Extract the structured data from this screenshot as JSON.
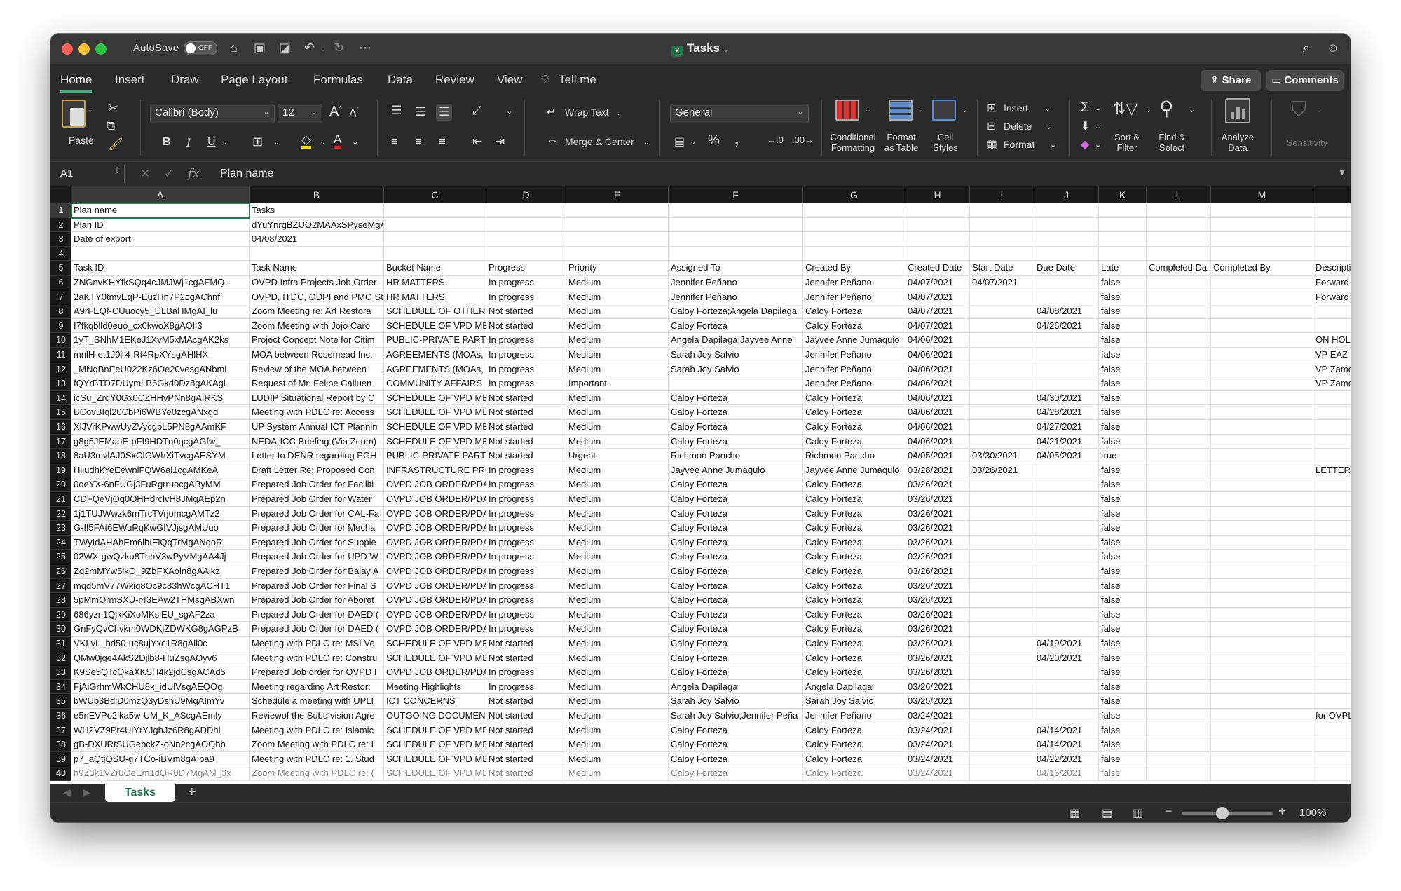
{
  "titlebar": {
    "autosave_label": "AutoSave",
    "autosave_state": "OFF",
    "doc_title": "Tasks",
    "xl_icon_letter": "X"
  },
  "ribbon_tabs": [
    "Home",
    "Insert",
    "Draw",
    "Page Layout",
    "Formulas",
    "Data",
    "Review",
    "View",
    "Tell me"
  ],
  "actions": {
    "share": "Share",
    "comments": "Comments"
  },
  "ribbon": {
    "paste": "Paste",
    "font_name": "Calibri (Body)",
    "font_size": "12",
    "wrap_text": "Wrap Text",
    "merge_center": "Merge & Center",
    "number_format": "General",
    "conditional_formatting": [
      "Conditional",
      "Formatting"
    ],
    "format_as_table": [
      "Format",
      "as Table"
    ],
    "cell_styles": [
      "Cell",
      "Styles"
    ],
    "insert": "Insert",
    "delete": "Delete",
    "format": "Format",
    "sort_filter": [
      "Sort &",
      "Filter"
    ],
    "find_select": [
      "Find &",
      "Select"
    ],
    "analyze_data": [
      "Analyze",
      "Data"
    ],
    "sensitivity": "Sensitivity",
    "bold": "B",
    "italic": "I",
    "underline": "U",
    "percent": "%",
    "comma": ",",
    "font_grow": "A",
    "font_shrink": "A"
  },
  "formula_bar": {
    "name_box": "A1",
    "fx": "fx",
    "formula": "Plan name"
  },
  "columns": [
    "A",
    "B",
    "C",
    "D",
    "E",
    "F",
    "G",
    "H",
    "I",
    "J",
    "K",
    "L",
    "M",
    ""
  ],
  "rows": [
    [
      "Plan name",
      "Tasks",
      "",
      "",
      "",
      "",
      "",
      "",
      "",
      "",
      "",
      "",
      "",
      ""
    ],
    [
      "Plan ID",
      "dYuYnrgBZUO2MAAxSPyseMgAFGOi",
      "",
      "",
      "",
      "",
      "",
      "",
      "",
      "",
      "",
      "",
      "",
      ""
    ],
    [
      "Date of export",
      "04/08/2021",
      "",
      "",
      "",
      "",
      "",
      "",
      "",
      "",
      "",
      "",
      "",
      ""
    ],
    [
      "",
      "",
      "",
      "",
      "",
      "",
      "",
      "",
      "",
      "",
      "",
      "",
      "",
      ""
    ],
    [
      "Task ID",
      "Task Name",
      "Bucket Name",
      "Progress",
      "Priority",
      "Assigned To",
      "Created By",
      "Created Date",
      "Start Date",
      "Due Date",
      "Late",
      "Completed Da",
      "Completed By",
      "Descripti"
    ],
    [
      "ZNGnvKHYfkSQq4cJMJWj1cgAFMQ-",
      "OVPD Infra Projects Job Order",
      "HR MATTERS",
      "In progress",
      "Medium",
      "Jennifer Peñano",
      "Jennifer Peñano",
      "04/07/2021",
      "04/07/2021",
      "",
      "false",
      "",
      "",
      "Forward"
    ],
    [
      "2aKTY0tmvEqP-EuzHn7P2cgAChnf",
      "OVPD, ITDC, ODPI and PMO St",
      "HR MATTERS",
      "In progress",
      "Medium",
      "Jennifer Peñano",
      "Jennifer Peñano",
      "04/07/2021",
      "",
      "",
      "false",
      "",
      "",
      "Forward"
    ],
    [
      "A9rFEQf-CUuocy5_ULBaHMgAI_lu",
      "Zoom Meeting re: Art Restora",
      "SCHEDULE OF OTHER I",
      "Not started",
      "Medium",
      "Caloy Forteza;Angela Dapilaga",
      "Caloy Forteza",
      "04/07/2021",
      "",
      "04/08/2021",
      "false",
      "",
      "",
      ""
    ],
    [
      "I7fkqblld0euo_cx0kwoX8gAOlI3",
      "Zoom Meeting with Jojo Caro",
      "SCHEDULE OF VPD ME",
      "Not started",
      "Medium",
      "Caloy Forteza",
      "Caloy Forteza",
      "04/07/2021",
      "",
      "04/26/2021",
      "false",
      "",
      "",
      ""
    ],
    [
      "1yT_SNhM1EKeJ1XvM5xMAcgAK2ks",
      "Project Concept Note for Citim",
      "PUBLIC-PRIVATE PART",
      "In progress",
      "Medium",
      "Angela Dapilaga;Jayvee Anne",
      "Jayvee Anne Jumaquio",
      "04/06/2021",
      "",
      "",
      "false",
      "",
      "",
      "ON HOLD"
    ],
    [
      "mnlH-et1J0i-4-Rt4RpXYsgAHlHX",
      "MOA between Rosemead Inc.",
      "AGREEMENTS (MOAs,",
      "In progress",
      "Medium",
      "Sarah Joy Salvio",
      "Jennifer Peñano",
      "04/06/2021",
      "",
      "",
      "false",
      "",
      "",
      "VP EAZ t"
    ],
    [
      "_MNqBnEeU022Kz6Oe20vesgANbml",
      "Review of the MOA between",
      "AGREEMENTS (MOAs,",
      "In progress",
      "Medium",
      "Sarah Joy Salvio",
      "Jennifer Peñano",
      "04/06/2021",
      "",
      "",
      "false",
      "",
      "",
      "VP Zamo"
    ],
    [
      "fQYrBTD7DUymLB6Gkd0Dz8gAKAgl",
      "Request of Mr. Felipe Calluen",
      "COMMUNITY AFFAIRS",
      "In progress",
      "Important",
      "",
      "Jennifer Peñano",
      "04/06/2021",
      "",
      "",
      "false",
      "",
      "",
      "VP Zamo"
    ],
    [
      "icSu_ZrdY0Gx0CZHHvPNn8gAIRKS",
      "LUDIP Situational Report by C",
      "SCHEDULE OF VPD ME",
      "Not started",
      "Medium",
      "Caloy Forteza",
      "Caloy Forteza",
      "04/06/2021",
      "",
      "04/30/2021",
      "false",
      "",
      "",
      ""
    ],
    [
      "BCovBIql20CbPi6WBYe0zcgANxgd",
      "Meeting with PDLC re: Access",
      "SCHEDULE OF VPD ME",
      "Not started",
      "Medium",
      "Caloy Forteza",
      "Caloy Forteza",
      "04/06/2021",
      "",
      "04/28/2021",
      "false",
      "",
      "",
      ""
    ],
    [
      "XlJVrKPwwUyZVycgpL5PN8gAAmKF",
      "UP System Annual ICT Plannin",
      "SCHEDULE OF VPD ME",
      "Not started",
      "Medium",
      "Caloy Forteza",
      "Caloy Forteza",
      "04/06/2021",
      "",
      "04/27/2021",
      "false",
      "",
      "",
      ""
    ],
    [
      "g8g5JEMaoE-pFI9HDTq0qcgAGfw_",
      "NEDA-ICC Briefing (Via Zoom)",
      "SCHEDULE OF VPD ME",
      "Not started",
      "Medium",
      "Caloy Forteza",
      "Caloy Forteza",
      "04/06/2021",
      "",
      "04/21/2021",
      "false",
      "",
      "",
      ""
    ],
    [
      "8aU3mvlAJ0SxCIGWhXiTvcgAESYM",
      "Letter to DENR regarding PGH",
      "PUBLIC-PRIVATE PART",
      "Not started",
      "Urgent",
      "Richmon Pancho",
      "Richmon Pancho",
      "04/05/2021",
      "03/30/2021",
      "04/05/2021",
      "true",
      "",
      "",
      ""
    ],
    [
      "HiiudhkYeEewnlFQW6al1cgAMKeA",
      "Draft Letter Re: Proposed Con",
      "INFRASTRUCTURE PRC",
      "In progress",
      "Medium",
      "Jayvee Anne Jumaquio",
      "Jayvee Anne Jumaquio",
      "03/28/2021",
      "03/26/2021",
      "",
      "false",
      "",
      "",
      "LETTER C"
    ],
    [
      "0oeYX-6nFUGj3FuRgrruocgAByMM",
      "Prepared Job Order for Faciliti",
      "OVPD JOB ORDER/PDA",
      "In progress",
      "Medium",
      "Caloy Forteza",
      "Caloy Forteza",
      "03/26/2021",
      "",
      "",
      "false",
      "",
      "",
      ""
    ],
    [
      "CDFQeVjOq0OHHdrclvH8JMgAEp2n",
      "Prepared Job Order for Water",
      "OVPD JOB ORDER/PDA",
      "In progress",
      "Medium",
      "Caloy Forteza",
      "Caloy Forteza",
      "03/26/2021",
      "",
      "",
      "false",
      "",
      "",
      ""
    ],
    [
      "1j1TUJWwzk6mTrcTVrjomcgAMTz2",
      "Prepared Job Order for CAL-Fa",
      "OVPD JOB ORDER/PDA",
      "In progress",
      "Medium",
      "Caloy Forteza",
      "Caloy Forteza",
      "03/26/2021",
      "",
      "",
      "false",
      "",
      "",
      ""
    ],
    [
      "G-ff5FAt6EWuRqKwGIVJjsgAMUuo",
      "Prepared Job Order for Mecha",
      "OVPD JOB ORDER/PDA",
      "In progress",
      "Medium",
      "Caloy Forteza",
      "Caloy Forteza",
      "03/26/2021",
      "",
      "",
      "false",
      "",
      "",
      ""
    ],
    [
      "TWyIdAHAhEm6lbIElQqTrMgANqoR",
      "Prepared Job Order for Supple",
      "OVPD JOB ORDER/PDA",
      "In progress",
      "Medium",
      "Caloy Forteza",
      "Caloy Forteza",
      "03/26/2021",
      "",
      "",
      "false",
      "",
      "",
      ""
    ],
    [
      "02WX-gwQzku8ThhV3wPyVMgAA4Jj",
      "Prepared Job Order for UPD W",
      "OVPD JOB ORDER/PDA",
      "In progress",
      "Medium",
      "Caloy Forteza",
      "Caloy Forteza",
      "03/26/2021",
      "",
      "",
      "false",
      "",
      "",
      ""
    ],
    [
      "Zq2mMYw5lkO_9ZbFXAoln8gAAikz",
      "Prepared Job Order for Balay A",
      "OVPD JOB ORDER/PDA",
      "In progress",
      "Medium",
      "Caloy Forteza",
      "Caloy Forteza",
      "03/26/2021",
      "",
      "",
      "false",
      "",
      "",
      ""
    ],
    [
      "mqd5mV77Wkiq8Oc9c83hWcgACHT1",
      "Prepared Job Order for Final S",
      "OVPD JOB ORDER/PDA",
      "In progress",
      "Medium",
      "Caloy Forteza",
      "Caloy Forteza",
      "03/26/2021",
      "",
      "",
      "false",
      "",
      "",
      ""
    ],
    [
      "5pMmOrmSXU-r43EAw2THMsgABXwn",
      "Prepared Job Order for Aboret",
      "OVPD JOB ORDER/PDA",
      "In progress",
      "Medium",
      "Caloy Forteza",
      "Caloy Forteza",
      "03/26/2021",
      "",
      "",
      "false",
      "",
      "",
      ""
    ],
    [
      "686yzn1QjkKiXoMKslEU_sgAF2za",
      "Prepared Job Order for DAED (",
      "OVPD JOB ORDER/PDA",
      "In progress",
      "Medium",
      "Caloy Forteza",
      "Caloy Forteza",
      "03/26/2021",
      "",
      "",
      "false",
      "",
      "",
      ""
    ],
    [
      "GnFyQvChvkm0WDKjZDWKG8gAGPzB",
      "Prepared Job Order for DAED (",
      "OVPD JOB ORDER/PDA",
      "In progress",
      "Medium",
      "Caloy Forteza",
      "Caloy Forteza",
      "03/26/2021",
      "",
      "",
      "false",
      "",
      "",
      ""
    ],
    [
      "VKLvL_bd50-uc8ujYxc1R8gAll0c",
      "Meeting with PDLC re: MSI Ve",
      "SCHEDULE OF VPD ME",
      "Not started",
      "Medium",
      "Caloy Forteza",
      "Caloy Forteza",
      "03/26/2021",
      "",
      "04/19/2021",
      "false",
      "",
      "",
      ""
    ],
    [
      "QMw0jge4AkS2Djlb8-HuZsgAOyv6",
      "Meeting with PDLC re: Constru",
      "SCHEDULE OF VPD ME",
      "Not started",
      "Medium",
      "Caloy Forteza",
      "Caloy Forteza",
      "03/26/2021",
      "",
      "04/20/2021",
      "false",
      "",
      "",
      ""
    ],
    [
      "K9Se5QTcQkaXKSH4k2jdCsgACAd5",
      "Prepared Job order for OVPD I",
      "OVPD JOB ORDER/PDA",
      "In progress",
      "Medium",
      "Caloy Forteza",
      "Caloy Forteza",
      "03/26/2021",
      "",
      "",
      "false",
      "",
      "",
      ""
    ],
    [
      "FjAiGrhmWkCHU8k_idUlVsgAEQOg",
      "Meeting regarding Art Restor:",
      "Meeting Highlights",
      "In progress",
      "Medium",
      "Angela Dapilaga",
      "Angela Dapilaga",
      "03/26/2021",
      "",
      "",
      "false",
      "",
      "",
      ""
    ],
    [
      "bWUb3BdlD0mzQ3yDsnU9MgAImYv",
      "Schedule a meeting with UPLI",
      "ICT CONCERNS",
      "Not started",
      "Medium",
      "Sarah Joy Salvio",
      "Sarah Joy Salvio",
      "03/25/2021",
      "",
      "",
      "false",
      "",
      "",
      ""
    ],
    [
      "e5nEVPo2lka5w-UM_K_AScgAEmly",
      "Reviewof the Subdivision Agre",
      "OUTGOING DOCUMEN",
      "Not started",
      "Medium",
      "Sarah Joy Salvio;Jennifer Peña",
      "Jennifer Peñano",
      "03/24/2021",
      "",
      "",
      "false",
      "",
      "",
      "for OVPL"
    ],
    [
      "WH2VZ9Pr4UiYrYJghJz6R8gADDhl",
      "Meeting with PDLC re: Islamic",
      "SCHEDULE OF VPD ME",
      "Not started",
      "Medium",
      "Caloy Forteza",
      "Caloy Forteza",
      "03/24/2021",
      "",
      "04/14/2021",
      "false",
      "",
      "",
      ""
    ],
    [
      "gB-DXURtSUGebckZ-oNn2cgAOQhb",
      "Zoom Meeting with PDLC re: I",
      "SCHEDULE OF VPD ME",
      "Not started",
      "Medium",
      "Caloy Forteza",
      "Caloy Forteza",
      "03/24/2021",
      "",
      "04/14/2021",
      "false",
      "",
      "",
      ""
    ],
    [
      "p7_aQtjQSU-g7TCo-iBVm8gAIba9",
      "Meeting with PDLC re: 1. Stud",
      "SCHEDULE OF VPD ME",
      "Not started",
      "Medium",
      "Caloy Forteza",
      "Caloy Forteza",
      "03/24/2021",
      "",
      "04/22/2021",
      "false",
      "",
      "",
      ""
    ],
    [
      "h9Z3k1VZr0OeEm1dQR0D7MgAM_3x",
      "Zoom Meeting with PDLC re: (",
      "SCHEDULE OF VPD ME",
      "Not started",
      "Medium",
      "Caloy Forteza",
      "Caloy Forteza",
      "03/24/2021",
      "",
      "04/16/2021",
      "false",
      "",
      "",
      ""
    ]
  ],
  "sheet_tabs": [
    "Tasks"
  ],
  "add_sheet": "+",
  "zoom": {
    "label": "100%",
    "minus": "−",
    "plus": "+"
  }
}
